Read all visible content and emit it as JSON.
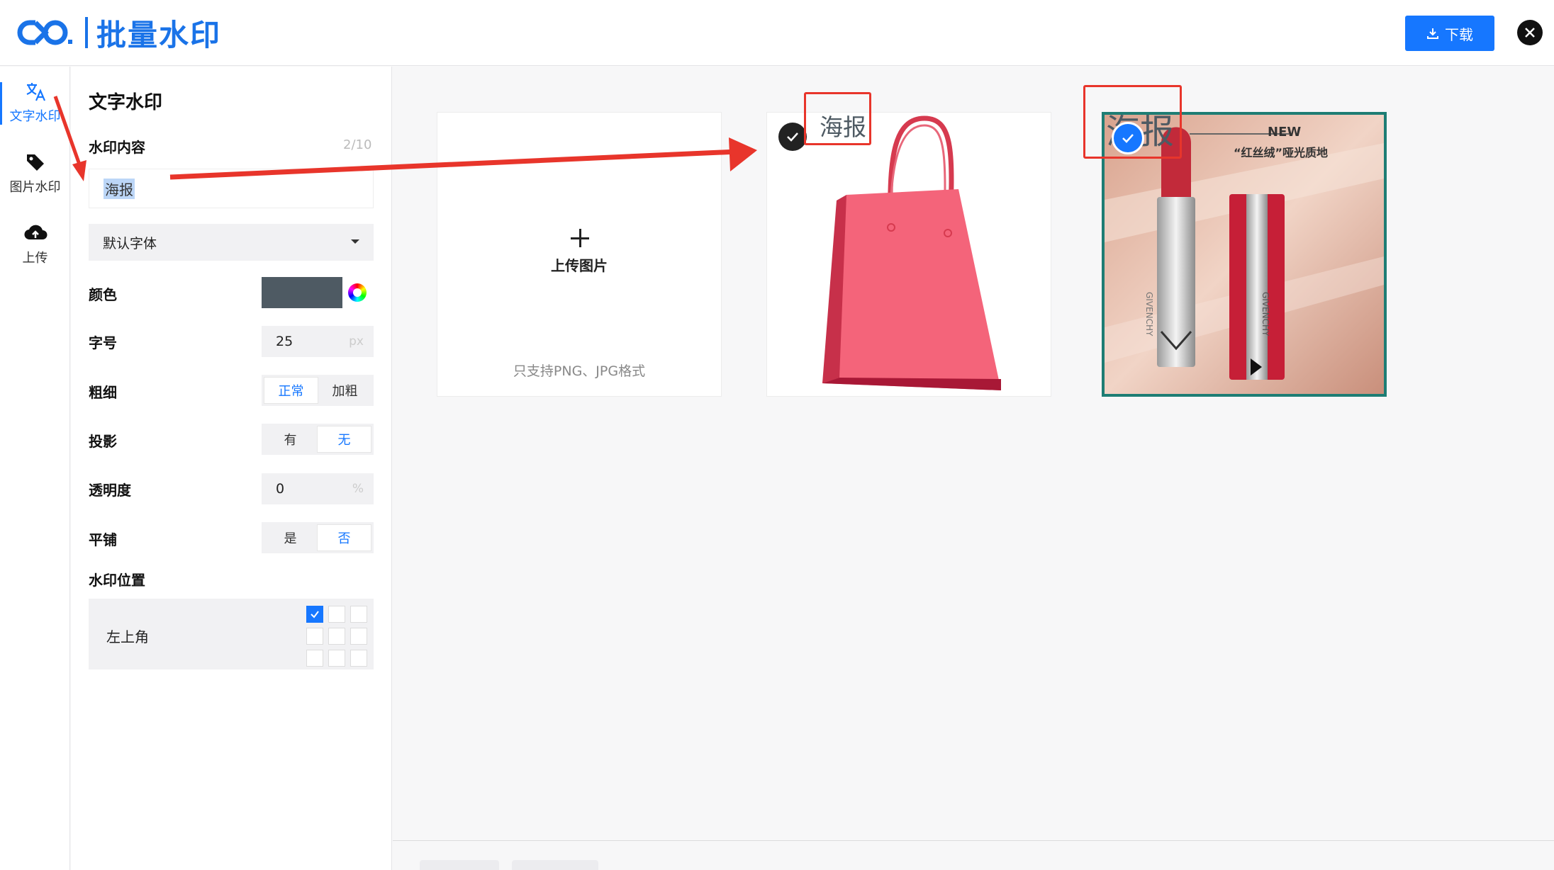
{
  "app": {
    "title": "批量水印"
  },
  "toolbar": {
    "download_label": "下载"
  },
  "rail": {
    "items": [
      {
        "label": "文字水印",
        "icon": "translate-icon",
        "active": true
      },
      {
        "label": "图片水印",
        "icon": "tag-icon",
        "active": false
      },
      {
        "label": "上传",
        "icon": "cloud-upload-icon",
        "active": false
      }
    ]
  },
  "panel": {
    "title": "文字水印",
    "content_label": "水印内容",
    "content_counter": "2/10",
    "content_value": "海报",
    "font_select": "默认字体",
    "color_label": "颜色",
    "color_value": "#4e5a63",
    "size_label": "字号",
    "size_value": "25",
    "size_unit": "px",
    "weight_label": "粗细",
    "weight_options": [
      "正常",
      "加粗"
    ],
    "weight_selected": "正常",
    "shadow_label": "投影",
    "shadow_options": [
      "有",
      "无"
    ],
    "shadow_selected": "无",
    "opacity_label": "透明度",
    "opacity_value": "0",
    "opacity_unit": "%",
    "tile_label": "平铺",
    "tile_options": [
      "是",
      "否"
    ],
    "tile_selected": "否",
    "position_label": "水印位置",
    "position_value": "左上角"
  },
  "gallery": {
    "upload": {
      "label": "上传图片",
      "hint": "只支持PNG、JPG格式"
    },
    "watermark_text": "海报",
    "lipstick_new": "NEW",
    "lipstick_tagline": "“红丝绒”哑光质地",
    "lipstick_brand": "GIVENCHY"
  },
  "colors": {
    "accent": "#1677ff",
    "annotation": "#e8352b"
  }
}
